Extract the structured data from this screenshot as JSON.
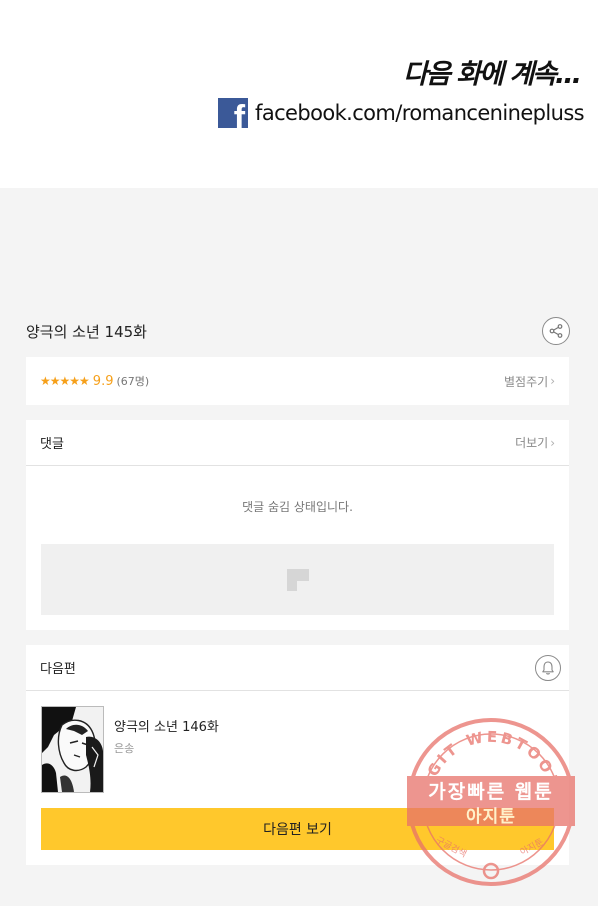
{
  "banner": {
    "next_text": "다음 화에 계속…",
    "facebook_url": "facebook.com/romanceninepluss"
  },
  "episode": {
    "title": "양극의 소년 145화"
  },
  "rating": {
    "stars": "★★★★★",
    "score": "9.9",
    "count": "(67명)",
    "rate_label": "별점주기"
  },
  "comments": {
    "title": "댓글",
    "more_label": "더보기",
    "hidden_message": "댓글 숨김 상태입니다."
  },
  "next_episode": {
    "header": "다음편",
    "title": "양극의 소년 146화",
    "author": "은송",
    "button_label": "다음편 보기"
  },
  "watermark": {
    "ring_text": "AGIT WEBTOON",
    "line1": "가장빠른 웹툰",
    "line2": "아지툰",
    "bottom_left": "구글검색",
    "bottom_right": "아지툰"
  },
  "colors": {
    "accent_yellow": "#ffc82c",
    "star_orange": "#f6a01a",
    "facebook_blue": "#3b5998",
    "watermark_red": "#e8726a"
  }
}
